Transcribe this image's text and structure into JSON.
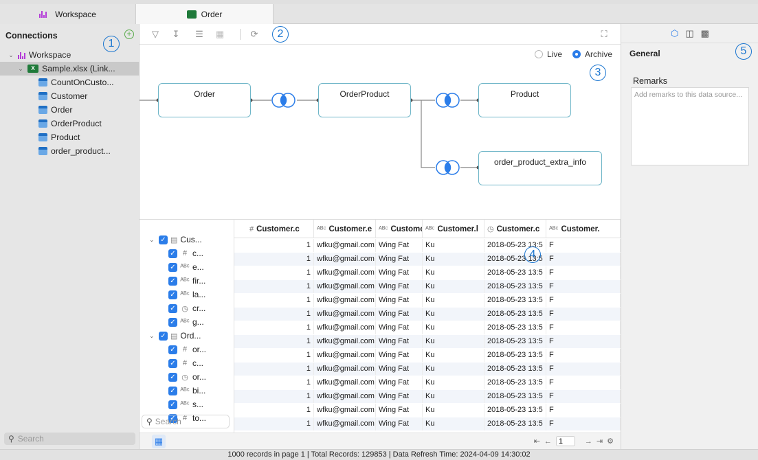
{
  "tabs": [
    {
      "label": "Workspace",
      "icon": "workspace-icon"
    },
    {
      "label": "Order",
      "icon": "table-icon"
    }
  ],
  "left": {
    "title": "Connections",
    "workspace": "Workspace",
    "file": "Sample.xlsx (Link...",
    "tables": [
      "CountOnCusto...",
      "Customer",
      "Order",
      "OrderProduct",
      "Product",
      "order_product..."
    ],
    "search_placeholder": "Search"
  },
  "diagram": {
    "live_label": "Live",
    "archive_label": "Archive",
    "nodes": [
      "Order",
      "OrderProduct",
      "Product",
      "order_product_extra_info"
    ]
  },
  "callouts": [
    "1",
    "2",
    "3",
    "4",
    "5"
  ],
  "fields": {
    "groups": [
      {
        "label": "Cus...",
        "items": [
          {
            "type": "#",
            "label": "c..."
          },
          {
            "type": "ABC",
            "label": "e..."
          },
          {
            "type": "ABC",
            "label": "fir..."
          },
          {
            "type": "ABC",
            "label": "la..."
          },
          {
            "type": "clock",
            "label": "cr..."
          },
          {
            "type": "ABC",
            "label": "g..."
          }
        ]
      },
      {
        "label": "Ord...",
        "items": [
          {
            "type": "#",
            "label": "or..."
          },
          {
            "type": "#",
            "label": "c..."
          },
          {
            "type": "clock",
            "label": "or..."
          },
          {
            "type": "ABC",
            "label": "bi..."
          },
          {
            "type": "ABC",
            "label": "s..."
          },
          {
            "type": "#",
            "label": "to..."
          }
        ]
      }
    ],
    "search_placeholder": "Search"
  },
  "grid": {
    "columns": [
      {
        "type": "#",
        "label": "Customer.c"
      },
      {
        "type": "ABC",
        "label": "Customer.e"
      },
      {
        "type": "ABC",
        "label": "Customer.f"
      },
      {
        "type": "ABC",
        "label": "Customer.l"
      },
      {
        "type": "clock",
        "label": "Customer.c"
      },
      {
        "type": "ABC",
        "label": "Customer."
      }
    ],
    "rows": [
      [
        "1",
        "wfku@gmail.com",
        "Wing Fat",
        "Ku",
        "2018-05-23 13:5",
        "F"
      ],
      [
        "1",
        "wfku@gmail.com",
        "Wing Fat",
        "Ku",
        "2018-05-23 13:5",
        "F"
      ],
      [
        "1",
        "wfku@gmail.com",
        "Wing Fat",
        "Ku",
        "2018-05-23 13:5",
        "F"
      ],
      [
        "1",
        "wfku@gmail.com",
        "Wing Fat",
        "Ku",
        "2018-05-23 13:5",
        "F"
      ],
      [
        "1",
        "wfku@gmail.com",
        "Wing Fat",
        "Ku",
        "2018-05-23 13:5",
        "F"
      ],
      [
        "1",
        "wfku@gmail.com",
        "Wing Fat",
        "Ku",
        "2018-05-23 13:5",
        "F"
      ],
      [
        "1",
        "wfku@gmail.com",
        "Wing Fat",
        "Ku",
        "2018-05-23 13:5",
        "F"
      ],
      [
        "1",
        "wfku@gmail.com",
        "Wing Fat",
        "Ku",
        "2018-05-23 13:5",
        "F"
      ],
      [
        "1",
        "wfku@gmail.com",
        "Wing Fat",
        "Ku",
        "2018-05-23 13:5",
        "F"
      ],
      [
        "1",
        "wfku@gmail.com",
        "Wing Fat",
        "Ku",
        "2018-05-23 13:5",
        "F"
      ],
      [
        "1",
        "wfku@gmail.com",
        "Wing Fat",
        "Ku",
        "2018-05-23 13:5",
        "F"
      ],
      [
        "1",
        "wfku@gmail.com",
        "Wing Fat",
        "Ku",
        "2018-05-23 13:5",
        "F"
      ],
      [
        "1",
        "wfku@gmail.com",
        "Wing Fat",
        "Ku",
        "2018-05-23 13:5",
        "F"
      ],
      [
        "1",
        "wfku@gmail.com",
        "Wing Fat",
        "Ku",
        "2018-05-23 13:5",
        "F"
      ]
    ]
  },
  "pager": {
    "page_value": "1"
  },
  "right": {
    "title": "General",
    "remarks_label": "Remarks",
    "remarks_placeholder": "Add remarks to this data source..."
  },
  "status": "1000 records in page 1   |   Total Records: 129853   |   Data Refresh Time: 2024-04-09 14:30:02",
  "colors": {
    "accent": "#2b7de9",
    "node_border": "#6fb6c8",
    "callout": "#1b76d0"
  }
}
